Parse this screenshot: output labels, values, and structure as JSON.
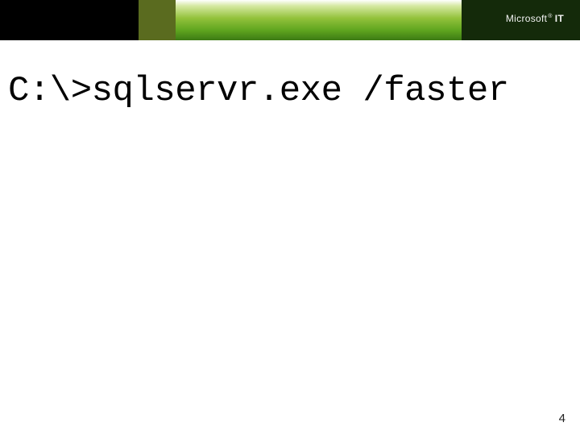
{
  "brand": {
    "main": "Microsoft",
    "sup": "®",
    "suffix": "IT"
  },
  "slide": {
    "command": "C:\\>sqlservr.exe /faster"
  },
  "footer": {
    "page_number": "4"
  }
}
